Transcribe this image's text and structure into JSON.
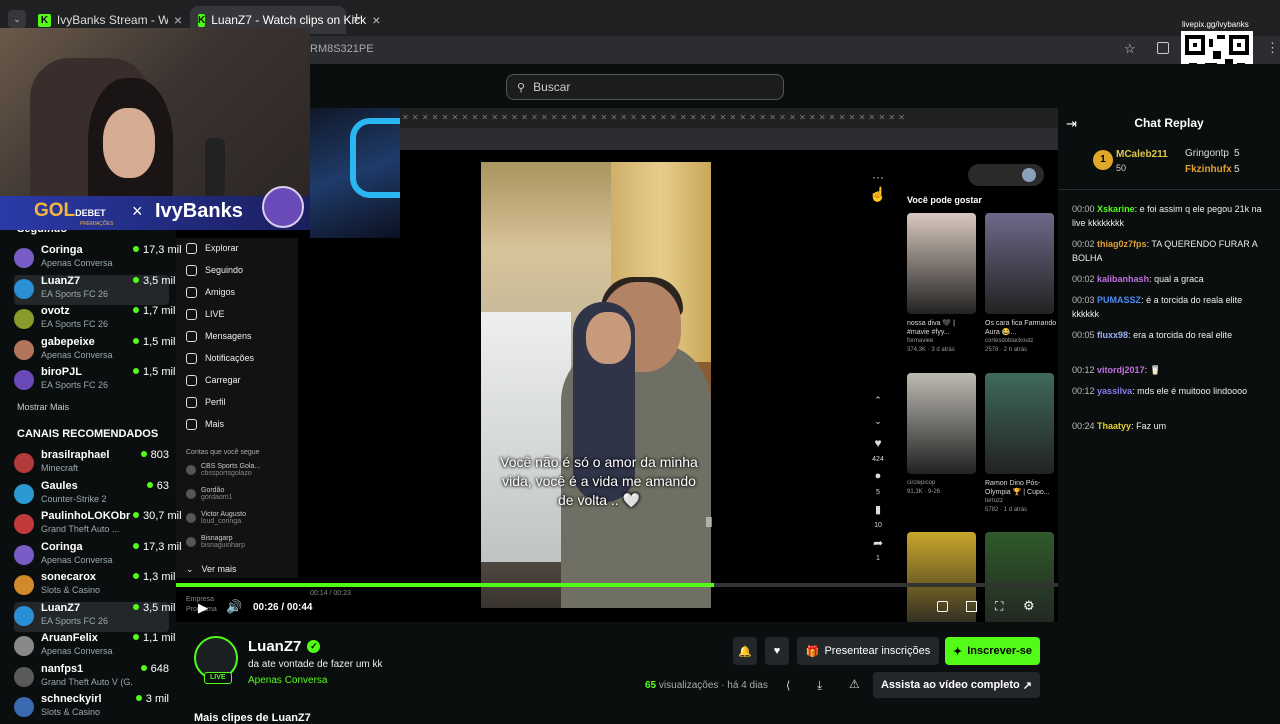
{
  "browser": {
    "tabs": [
      {
        "label": "IvyBanks Stream - Watch Live o"
      },
      {
        "label": "LuanZ7 - Watch clips on Kick"
      }
    ],
    "address_fragment": "RM8S321PE",
    "new_tab": "+"
  },
  "header": {
    "search_placeholder": "Buscar"
  },
  "overlay": {
    "sponsor_a": "GOL",
    "sponsor_b": "DEBET",
    "sponsor_sub": "PREMIAÇÕES",
    "times": "×",
    "streamer_name": "IvyBanks",
    "qr_label": "livepix.gg/ivybanks"
  },
  "sidebar": {
    "following_title": "Seguindo",
    "following": [
      {
        "name": "Coringa",
        "category": "Apenas Conversa",
        "viewers": "17,3 mil",
        "color": "#7a5cc7"
      },
      {
        "name": "LuanZ7",
        "category": "EA Sports FC 26",
        "viewers": "3,5 mil",
        "color": "#2b8fd6"
      },
      {
        "name": "ovotz",
        "category": "EA Sports FC 26",
        "viewers": "1,7 mil",
        "color": "#8a9a2a"
      },
      {
        "name": "gabepeixe",
        "category": "Apenas Conversa",
        "viewers": "1,5 mil",
        "color": "#b0755a"
      },
      {
        "name": "biroPJL",
        "category": "EA Sports FC 26",
        "viewers": "1,5 mil",
        "color": "#6a4ab8"
      }
    ],
    "show_more": "Mostrar Mais",
    "recommended_title": "CANAIS RECOMENDADOS",
    "recommended": [
      {
        "name": "brasilraphael",
        "category": "Minecraft",
        "viewers": "803",
        "color": "#b33a3a"
      },
      {
        "name": "Gaules",
        "category": "Counter-Strike 2",
        "viewers": "63",
        "color": "#2a9ad0"
      },
      {
        "name": "PaulinhoLOKObr",
        "category": "Grand Theft Auto ...",
        "viewers": "30,7 mil",
        "color": "#c23b3b"
      },
      {
        "name": "Coringa",
        "category": "Apenas Conversa",
        "viewers": "17,3 mil",
        "color": "#7a5cc7"
      },
      {
        "name": "sonecarox",
        "category": "Slots & Casino",
        "viewers": "1,3 mil",
        "color": "#d08a2a"
      },
      {
        "name": "LuanZ7",
        "category": "EA Sports FC 26",
        "viewers": "3,5 mil",
        "color": "#2b8fd6"
      },
      {
        "name": "AruanFelix",
        "category": "Apenas Conversa",
        "viewers": "1,1 mil",
        "color": "#888888"
      },
      {
        "name": "nanfps1",
        "category": "Grand Theft Auto V (G...",
        "viewers": "648",
        "color": "#5a5a5a"
      },
      {
        "name": "schneckyirl",
        "category": "Slots & Casino",
        "viewers": "3 mil",
        "color": "#3a6ab0"
      }
    ]
  },
  "tiktok": {
    "menu": [
      "Explorar",
      "Seguindo",
      "Amigos",
      "LIVE",
      "Mensagens",
      "Notificações",
      "Carregar",
      "Perfil",
      "Mais"
    ],
    "follows_title": "Contas que você segue",
    "accounts": [
      {
        "name": "CBS Sports Gola...",
        "handle": "cbssportsgolazo"
      },
      {
        "name": "Gordão",
        "handle": "gordaom1"
      },
      {
        "name": "Victor Augusto",
        "handle": "loud_coringa"
      },
      {
        "name": "Bisnagarp",
        "handle": "bisnaguinharp"
      }
    ],
    "see_more": "Ver mais",
    "footer": [
      "Empresa",
      "Programa"
    ],
    "caption": "Você não é só o amor da minha vida, você é a vida me amando de volta .. 🤍",
    "rail": {
      "likes": "424",
      "comments": "5",
      "saves": "10",
      "shares": "1",
      "dots": "···"
    },
    "inner_time": "00:14 / 00:23",
    "suggest_title": "Você pode gostar",
    "suggestions": [
      {
        "caption": "nossa diva 🖤 | #mavie #fyy...",
        "author": "formaviee",
        "meta": "374,3K · 3 d atrás",
        "color": "#d9c9bf"
      },
      {
        "caption": "Os cara fica Farmando Aura 😂...",
        "author": "cortesdoblackoutz",
        "meta": "2578 · 2 h atrás",
        "color": "#6d6a8a"
      },
      {
        "caption": "",
        "author": "circlepicop",
        "meta": "91,3K · 9-26",
        "color": "#bdbab2"
      },
      {
        "caption": "Ramon Dino Pós-Olympia 🏆 | Cupo...",
        "author": "tertuzz",
        "meta": "5782 · 1 d atrás",
        "color": "#3f6a5a"
      },
      {
        "caption": "",
        "author": "",
        "meta": "",
        "color": "#c9a52a"
      },
      {
        "caption": "",
        "author": "",
        "meta": "",
        "color": "#2f5a2a"
      }
    ]
  },
  "player": {
    "time": "00:26 / 00:44",
    "progress": 0.61
  },
  "channel": {
    "name": "LuanZ7",
    "live_badge": "LIVE",
    "clip_title": "da ate vontade de fazer um kk",
    "category": "Apenas Conversa",
    "views_count": "65",
    "views_label": "visualizações",
    "age": "há 4 dias",
    "gift_label": "Presentear inscrições",
    "subscribe_label": "Inscrever-se",
    "watch_full_label": "Assista ao vídeo completo",
    "more_clips": "Mais clipes de LuanZ7"
  },
  "chat": {
    "title": "Chat Replay",
    "gifters": [
      {
        "name": "MCaleb211",
        "value": "50",
        "rank": "1"
      },
      {
        "name": "Gringontp",
        "value": "5"
      },
      {
        "name": "Fkzinhufx",
        "value": "5"
      }
    ],
    "messages": [
      {
        "time": "00:00",
        "user": "Xskarine",
        "color": "#53fc18",
        "text": "e foi assim q ele pegou 21k na live kkkkkkkk"
      },
      {
        "time": "00:02",
        "user": "thiag0z7fps",
        "color": "#e0a030",
        "text": "TA QUERENDO FURAR A BOLHA"
      },
      {
        "time": "00:02",
        "user": "kalibanhash",
        "color": "#c070e0",
        "text": "qual a graca"
      },
      {
        "time": "00:03",
        "user": "PUMASSZ",
        "color": "#4a8af0",
        "text": "é a torcida do reala elite kkkkkk"
      },
      {
        "time": "00:05",
        "user": "fluxx98",
        "color": "#9ab0f0",
        "text": "era a torcida do real elite"
      },
      {
        "time": "00:12",
        "user": "vitordj2017",
        "color": "#c070e0",
        "text": "🥛"
      },
      {
        "time": "00:12",
        "user": "yassilva",
        "color": "#8a7af0",
        "text": "mds ele é muitooo lindoooo"
      },
      {
        "time": "00:24",
        "user": "Thaatyy",
        "color": "#e0d030",
        "text": "Faz um"
      }
    ]
  }
}
